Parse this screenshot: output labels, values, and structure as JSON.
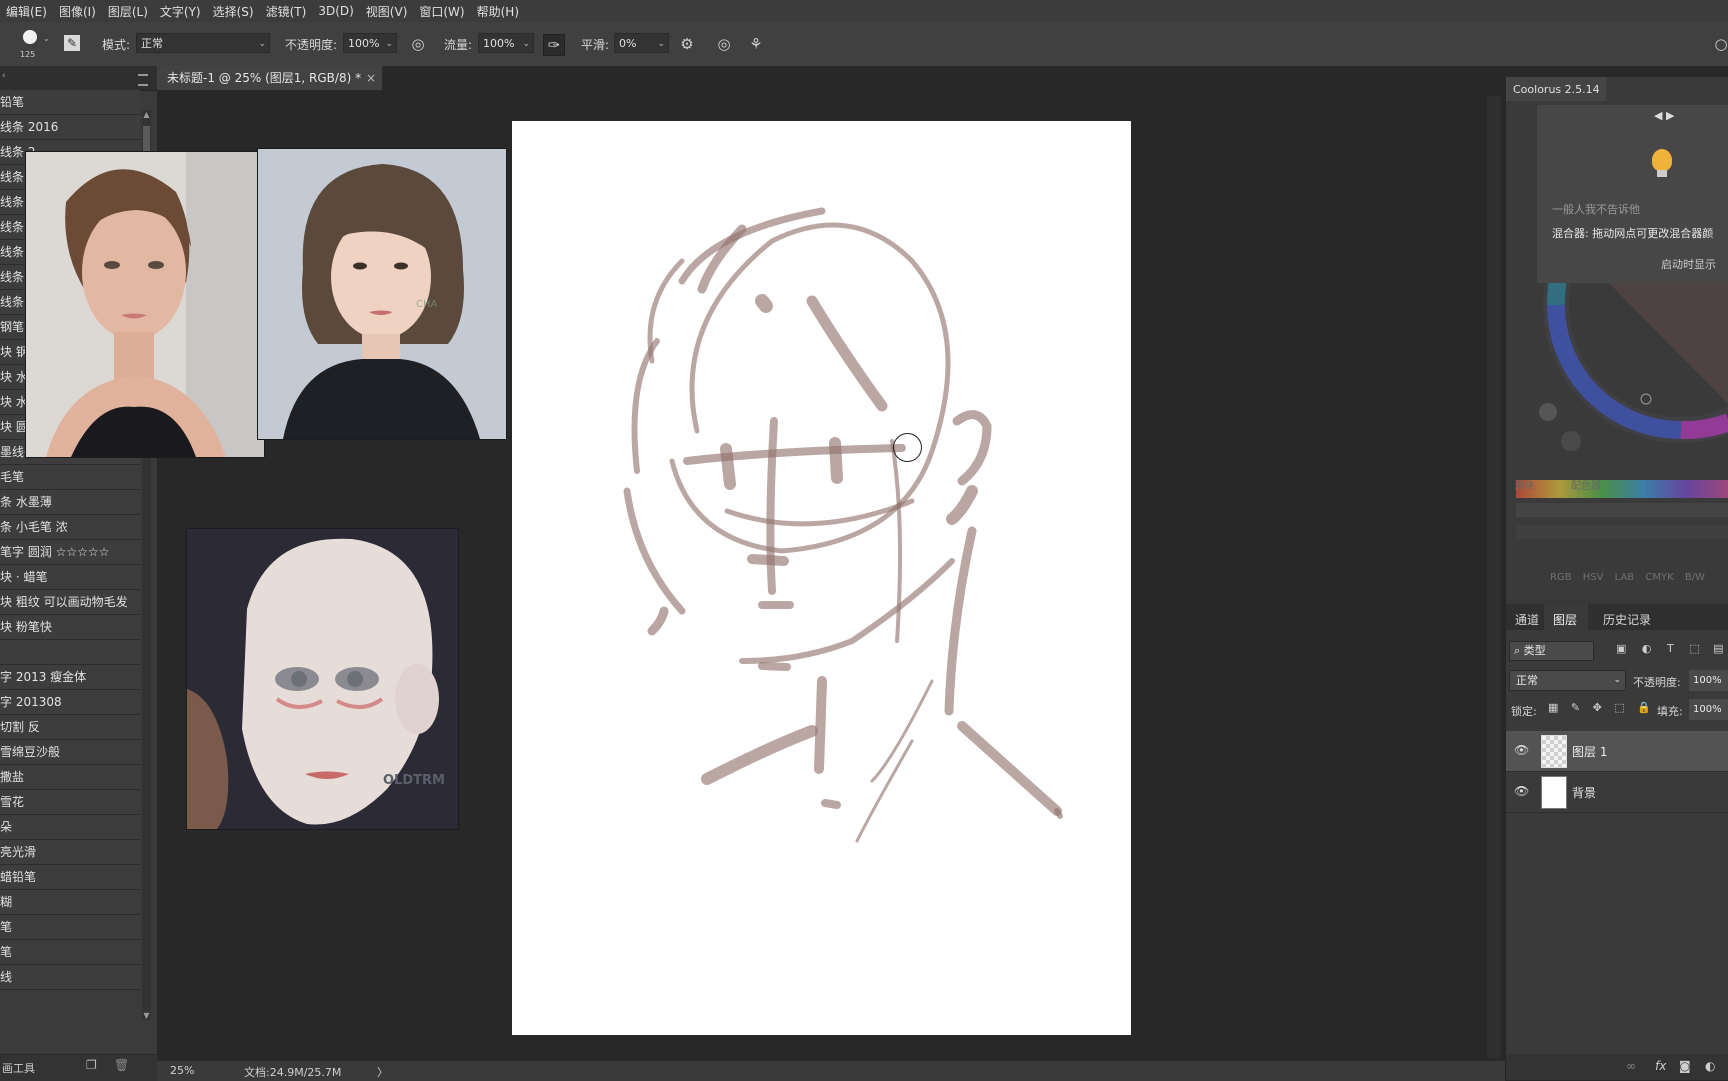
{
  "menu": [
    "编辑(E)",
    "图像(I)",
    "图层(L)",
    "文字(Y)",
    "选择(S)",
    "滤镜(T)",
    "3D(D)",
    "视图(V)",
    "窗口(W)",
    "帮助(H)"
  ],
  "options": {
    "brush_size": "125",
    "mode_label": "模式:",
    "mode_value": "正常",
    "opacity_label": "不透明度:",
    "opacity_value": "100%",
    "flow_label": "流量:",
    "flow_value": "100%",
    "smooth_label": "平滑:",
    "smooth_value": "0%"
  },
  "document_tab": {
    "title": "未标题-1 @ 25% (图层1, RGB/8) *",
    "close": "×"
  },
  "brushes": [
    "铅笔",
    "线条 2016",
    "线条 2",
    "线条 水",
    "线条 千",
    "线条 星",
    "线条 新",
    "线条 顺",
    "线条 小",
    "钢笔 浓",
    "块 钢",
    "块 水",
    "块 水",
    "块 圆",
    "墨线条 有纹理",
    "毛笔",
    "条 水墨薄",
    "条 小毛笔 浓",
    "笔字 圆润 ☆☆☆☆☆",
    "块 · 蜡笔",
    "块 粗纹 可以画动物毛发",
    "块 粉笔快",
    "",
    "字 2013 瘦金体",
    "字 201308",
    "切割 反",
    "雪绵豆沙般",
    "撒盐",
    "雪花",
    "朵",
    "亮光滑",
    "蜡铅笔",
    "糊",
    "笔",
    "笔",
    "线"
  ],
  "left_footer": {
    "label": "画工具"
  },
  "coolorus": {
    "title": "Coolorus 2.5.14",
    "nav": "◀ ▶",
    "hint1": "一般人我不告诉他",
    "hint2": "混合器: 拖动网点可更改混合器颜",
    "hint3": "启动时显示",
    "modes": [
      "RGB",
      "HSV",
      "LAB",
      "CMYK",
      "B/W"
    ],
    "tabs_faint": [
      "滑块",
      "配色器"
    ]
  },
  "layers_panel": {
    "tabs": [
      "通道",
      "图层",
      "历史记录"
    ],
    "filter": "类型",
    "blend": "正常",
    "opacity_label": "不透明度:",
    "opacity": "100%",
    "lock_label": "锁定:",
    "fill_label": "填充:",
    "fill": "100%",
    "layers": [
      {
        "name": "图层 1",
        "selected": true
      },
      {
        "name": "背景",
        "selected": false
      }
    ]
  },
  "status": {
    "zoom": "25%",
    "doc": "文档:24.9M/25.7M",
    "arrow": "〉"
  },
  "watermarks": {
    "chaos": "CHA",
    "doll": "OLDTRM"
  },
  "colors": {
    "accent": "#6b4b44",
    "sketch": "#8a6a62",
    "bg": "#282828",
    "panel": "#383838"
  }
}
